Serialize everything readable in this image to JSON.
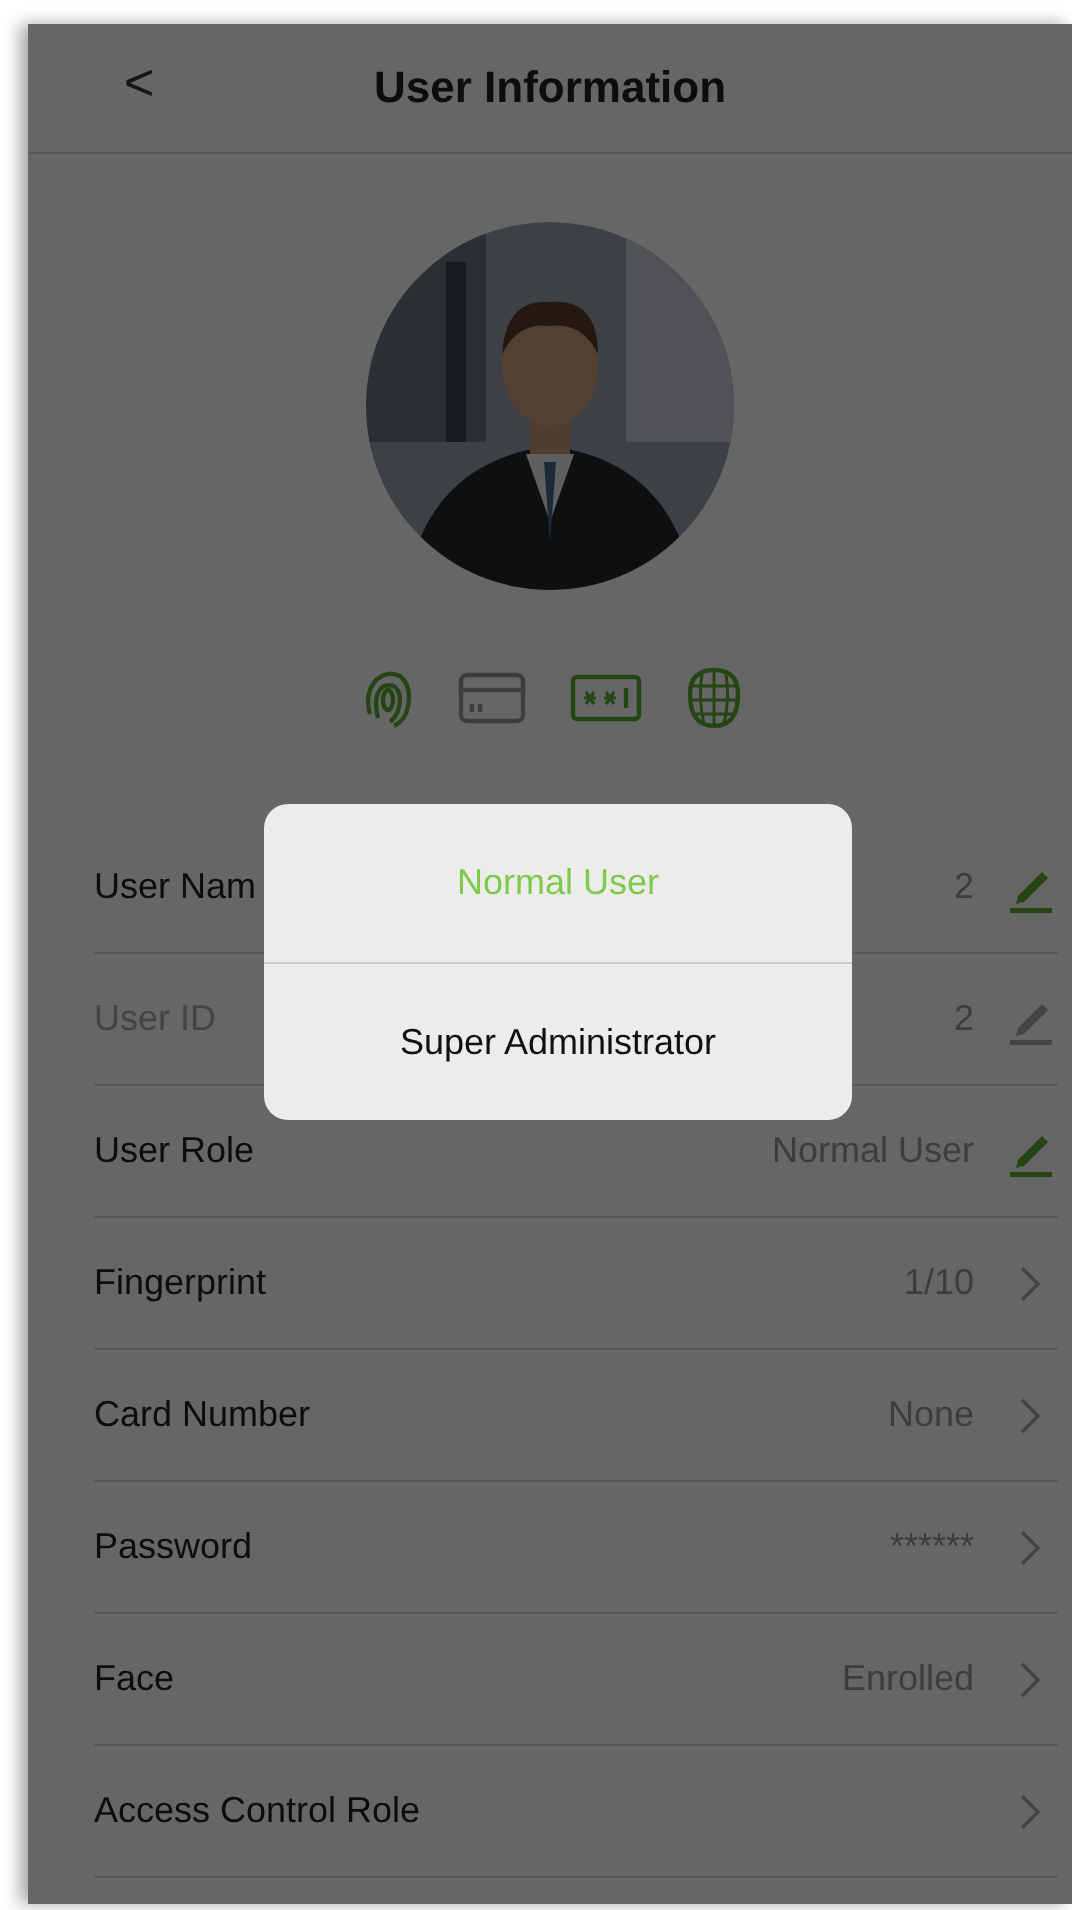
{
  "header": {
    "back": "<",
    "title": "User Information"
  },
  "credentials": [
    {
      "kind": "fingerprint",
      "enrolled": true
    },
    {
      "kind": "card",
      "enrolled": false
    },
    {
      "kind": "password",
      "enrolled": true
    },
    {
      "kind": "face",
      "enrolled": true
    }
  ],
  "rows": [
    {
      "label": "User Nam",
      "value": "2",
      "kind": "edit",
      "disabled": false
    },
    {
      "label": "User ID",
      "value": "2",
      "kind": "edit",
      "disabled": true
    },
    {
      "label": "User Role",
      "value": "Normal User",
      "kind": "edit",
      "disabled": false
    },
    {
      "label": "Fingerprint",
      "value": "1/10",
      "kind": "link",
      "disabled": false
    },
    {
      "label": "Card Number",
      "value": "None",
      "kind": "link",
      "disabled": false
    },
    {
      "label": "Password",
      "value": "******",
      "kind": "link",
      "disabled": false
    },
    {
      "label": "Face",
      "value": "Enrolled",
      "kind": "link",
      "disabled": false
    },
    {
      "label": "Access Control Role",
      "kind": "link",
      "disabled": false
    }
  ],
  "dialog": {
    "options": [
      {
        "label": "Normal User",
        "selected": true
      },
      {
        "label": "Super Administrator",
        "selected": false
      }
    ]
  }
}
